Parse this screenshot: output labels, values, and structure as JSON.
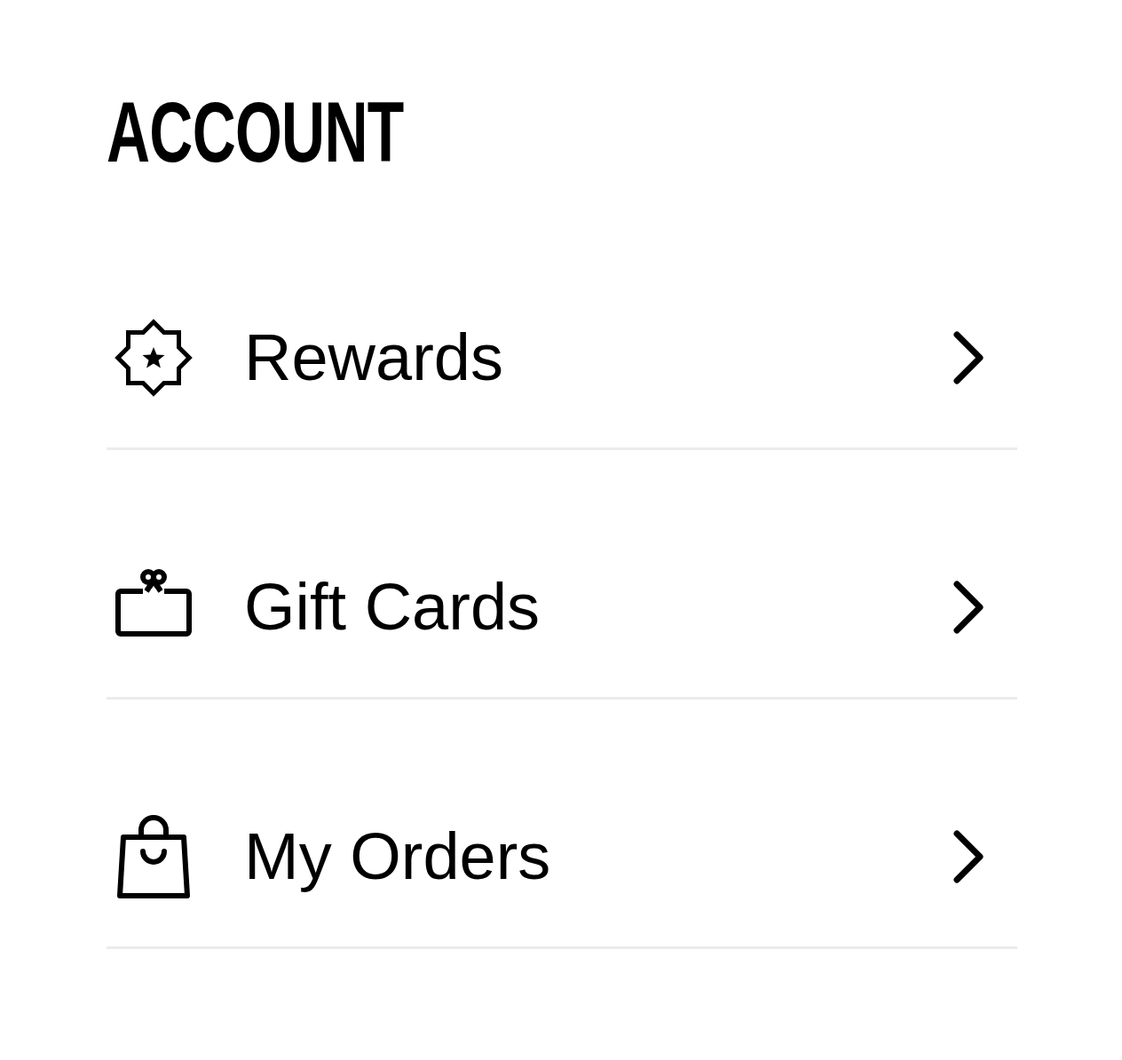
{
  "title": "ACCOUNT",
  "items": [
    {
      "label": "Rewards",
      "kind": "badge"
    },
    {
      "label": "Gift Cards",
      "kind": "gift"
    },
    {
      "label": "My Orders",
      "kind": "bag"
    }
  ]
}
